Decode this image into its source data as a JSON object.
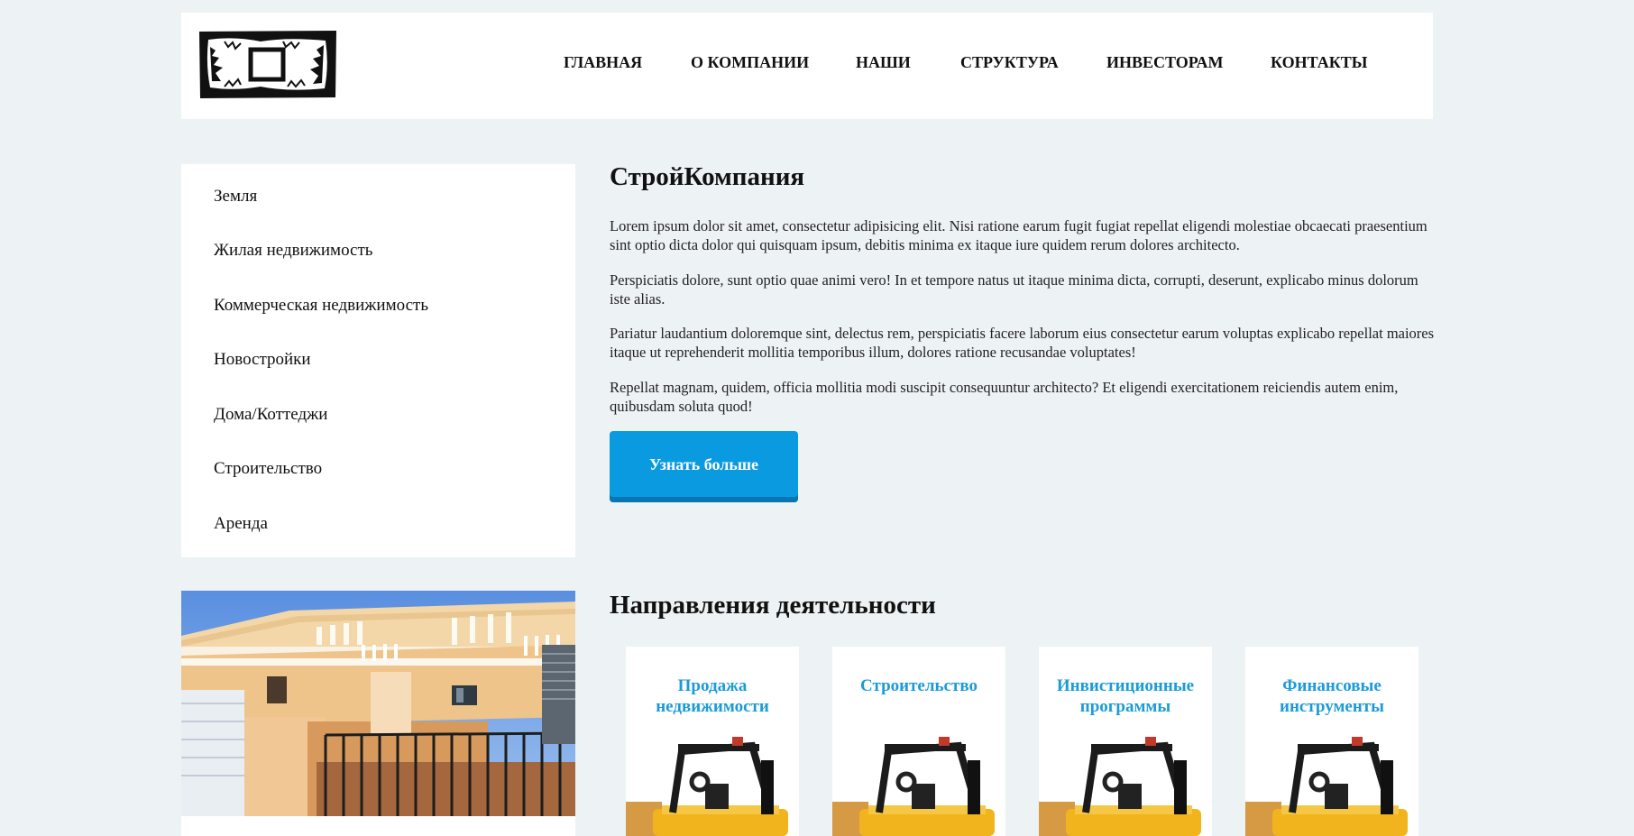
{
  "header": {
    "nav": [
      "ГЛАВНАЯ",
      "О КОМПАНИИ",
      "НАШИ",
      "СТРУКТУРА",
      "ИНВЕСТОРАМ",
      "КОНТАКТЫ"
    ]
  },
  "sidebar": {
    "items": [
      "Земля",
      "Жилая недвижимость",
      "Коммерческая недвижимость",
      "Новостройки",
      "Дома/Коттеджи",
      "Строительство",
      "Аренда"
    ]
  },
  "main": {
    "title": "СтройКомпания",
    "paragraphs": [
      "Lorem ipsum dolor sit amet, consectetur adipisicing elit. Nisi ratione earum fugit fugiat repellat eligendi molestiae obcaecati praesentium sint optio dicta dolor qui quisquam ipsum, debitis minima ex itaque iure quidem rerum dolores architecto.",
      "Perspiciatis dolore, sunt optio quae animi vero! In et tempore natus ut itaque minima dicta, corrupti, deserunt, explicabo minus dolorum iste alias.",
      "Pariatur laudantium doloremque sint, delectus rem, perspiciatis facere laborum eius consectetur earum voluptas explicabo repellat maiores itaque ut reprehenderit mollitia temporibus illum, dolores ratione recusandae voluptates!",
      "Repellat magnam, quidem, officia mollitia modi suscipit consequuntur architecto? Et eligendi exercitationem reiciendis autem enim, quibusdam soluta quod!"
    ],
    "cta_label": "Узнать больше"
  },
  "activities": {
    "title": "Направления деятельности",
    "cards": [
      {
        "line1": "Продажа",
        "line2": "недвижимости"
      },
      {
        "line1": "Строительство",
        "line2": ""
      },
      {
        "line1": "Инвистиционные",
        "line2": "программы"
      },
      {
        "line1": "Финансовые",
        "line2": "инструменты"
      }
    ]
  },
  "colors": {
    "page_bg": "#edf2f4",
    "accent": "#0a9ae0",
    "card_title": "#1a9bd7"
  }
}
